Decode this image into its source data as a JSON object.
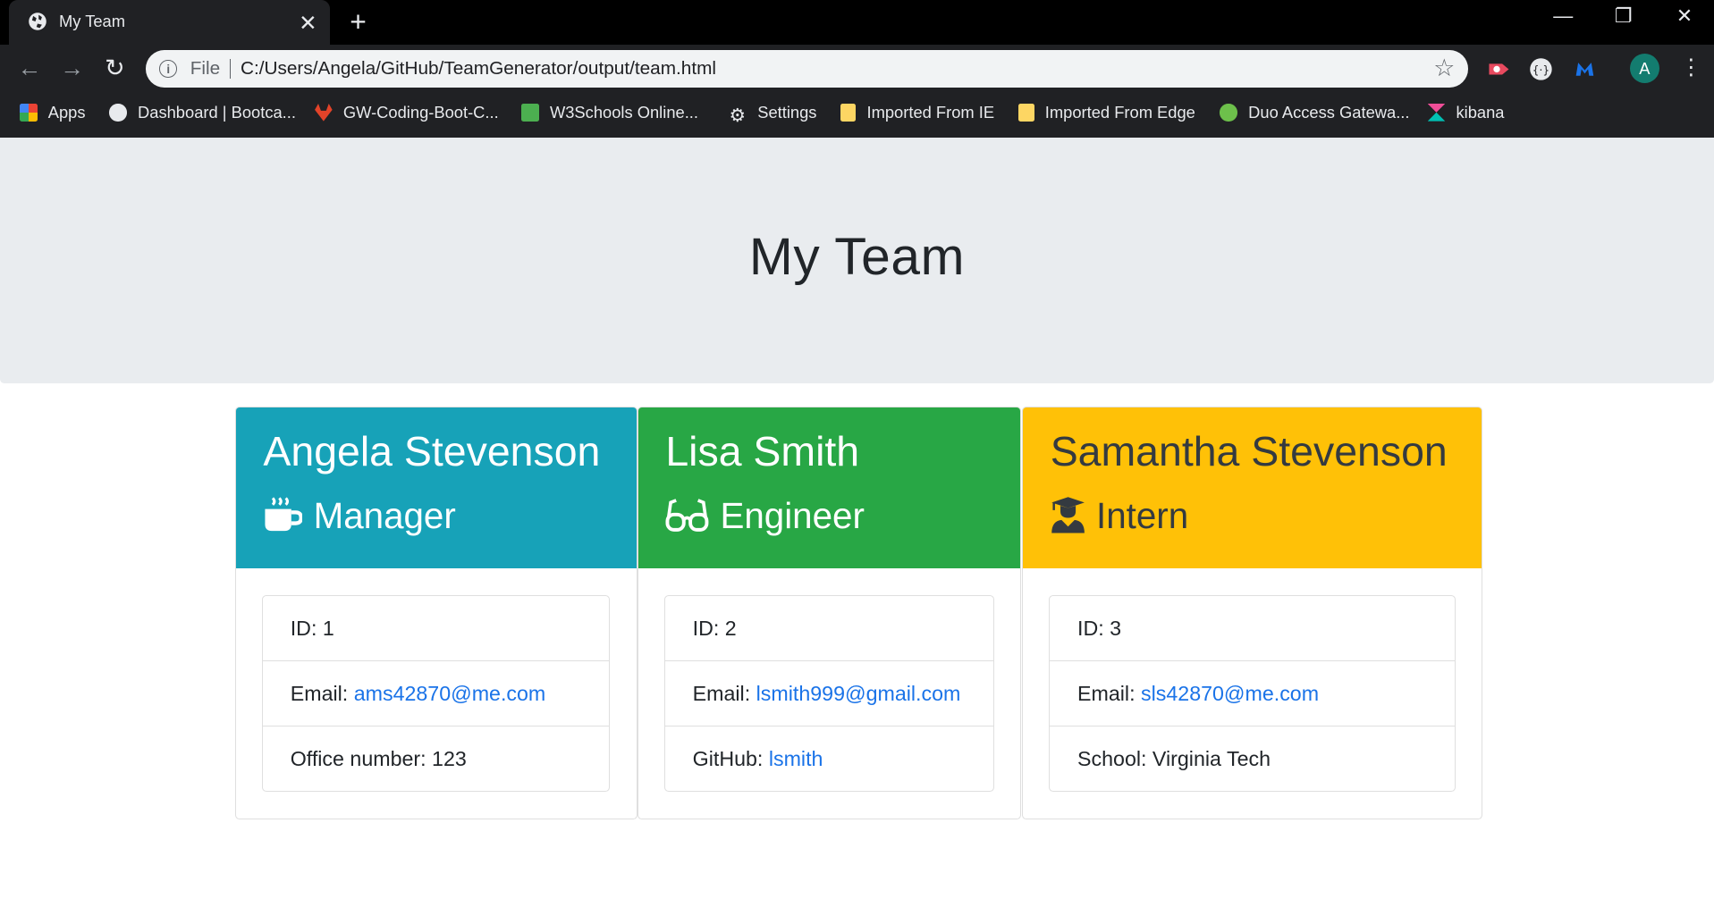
{
  "browser": {
    "tab_title": "My Team",
    "scheme_label": "File",
    "url": "C:/Users/Angela/GitHub/TeamGenerator/output/team.html",
    "avatar_letter": "A",
    "bookmarks": [
      {
        "label": "Apps"
      },
      {
        "label": "Dashboard | Bootca..."
      },
      {
        "label": "GW-Coding-Boot-C..."
      },
      {
        "label": "W3Schools Online..."
      },
      {
        "label": "Settings"
      },
      {
        "label": "Imported From IE"
      },
      {
        "label": "Imported From Edge"
      },
      {
        "label": "Duo Access Gatewa..."
      },
      {
        "label": "kibana"
      }
    ]
  },
  "page": {
    "title": "My Team",
    "members": [
      {
        "name": "Angela Stevenson",
        "role": "Manager",
        "role_icon": "mug-icon",
        "color": "#17a2b8",
        "text_color": "#ffffff",
        "id_label": "ID: ",
        "id": "1",
        "email_label": "Email: ",
        "email": "ams42870@me.com",
        "extra_label": "Office number: ",
        "extra_value": "123",
        "extra_is_link": false
      },
      {
        "name": "Lisa Smith",
        "role": "Engineer",
        "role_icon": "glasses-icon",
        "color": "#28a745",
        "text_color": "#ffffff",
        "id_label": "ID: ",
        "id": "2",
        "email_label": "Email: ",
        "email": "lsmith999@gmail.com",
        "extra_label": "GitHub: ",
        "extra_value": "lsmith",
        "extra_is_link": true
      },
      {
        "name": "Samantha Stevenson",
        "role": "Intern",
        "role_icon": "graduate-icon",
        "color": "#ffc107",
        "text_color": "#343a40",
        "id_label": "ID: ",
        "id": "3",
        "email_label": "Email: ",
        "email": "sls42870@me.com",
        "extra_label": "School: ",
        "extra_value": "Virginia Tech",
        "extra_is_link": false
      }
    ]
  }
}
